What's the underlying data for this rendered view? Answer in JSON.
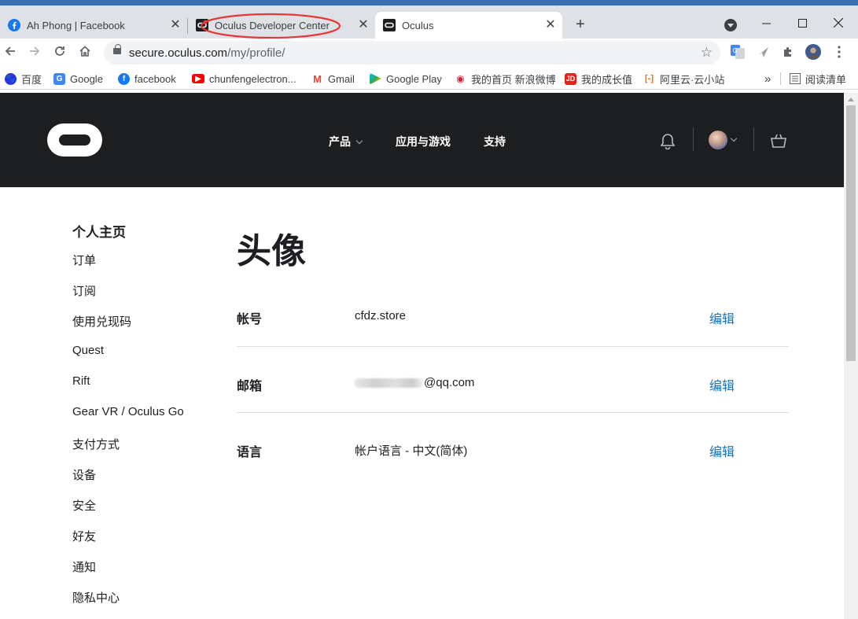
{
  "browser": {
    "tabs": [
      {
        "title": "Ah Phong | Facebook",
        "favicon": "facebook-icon",
        "active": false
      },
      {
        "title": "Oculus Developer Center",
        "favicon": "oculus-dev-icon",
        "active": false
      },
      {
        "title": "Oculus",
        "favicon": "oculus-icon",
        "active": true
      }
    ],
    "new_tab_label": "+",
    "url_host": "secure.oculus.com",
    "url_path": "/my/profile/",
    "bookmarks": [
      {
        "label": "百度",
        "icon": "baidu-icon"
      },
      {
        "label": "Google",
        "icon": "google-translate-icon"
      },
      {
        "label": "facebook",
        "icon": "facebook-icon"
      },
      {
        "label": "chunfengelectron...",
        "icon": "youtube-icon"
      },
      {
        "label": "Gmail",
        "icon": "gmail-icon"
      },
      {
        "label": "Google Play",
        "icon": "google-play-icon"
      },
      {
        "label": "我的首页 新浪微博",
        "icon": "weibo-icon"
      },
      {
        "label": "我的成长值",
        "icon": "jd-icon"
      },
      {
        "label": "阿里云·云小站",
        "icon": "aliyun-icon"
      }
    ],
    "bookmarks_overflow": "»",
    "reading_list_label": "阅读清单",
    "colors": {
      "tabbar": "#dee1e6",
      "annotation_circle": "#e53935"
    }
  },
  "site": {
    "nav": [
      {
        "label": "产品",
        "has_dropdown": true
      },
      {
        "label": "应用与游戏",
        "has_dropdown": false
      },
      {
        "label": "支持",
        "has_dropdown": false
      }
    ],
    "colors": {
      "header_bg": "#1c1e20",
      "link": "#1b72b6"
    }
  },
  "sidebar": {
    "items": [
      "个人主页",
      "订单",
      "订阅",
      "使用兑现码",
      "Quest",
      "Rift",
      "Gear VR / Oculus Go",
      "支付方式",
      "设备",
      "安全",
      "好友",
      "通知",
      "隐私中心"
    ]
  },
  "profile": {
    "title": "头像",
    "rows": [
      {
        "label": "帐号",
        "value": "cfdz.store",
        "action": "编辑"
      },
      {
        "label": "邮箱",
        "value": "@qq.com",
        "action": "编辑",
        "value_partially_blurred": true
      },
      {
        "label": "语言",
        "value": "帐户语言 - 中文(简体)",
        "action": "编辑"
      }
    ]
  }
}
